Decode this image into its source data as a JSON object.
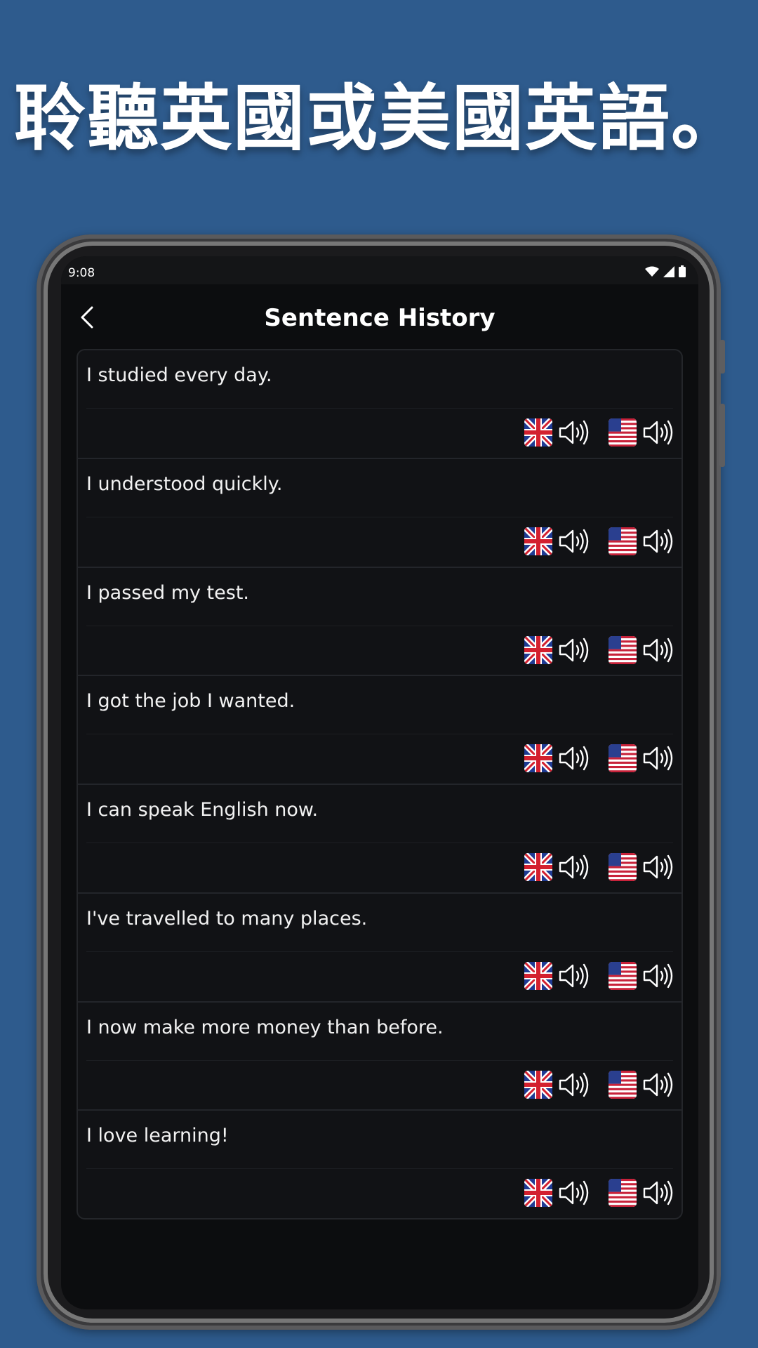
{
  "headline": "聆聽英國或美國英語。",
  "status_bar": {
    "time": "9:08"
  },
  "app_bar": {
    "title": "Sentence History"
  },
  "sentences": [
    {
      "text": "I studied every day."
    },
    {
      "text": "I understood quickly."
    },
    {
      "text": "I passed my test."
    },
    {
      "text": "I got the job I wanted."
    },
    {
      "text": "I can speak English now."
    },
    {
      "text": "I've travelled to many places."
    },
    {
      "text": "I now make more money than before."
    },
    {
      "text": "I love learning!"
    }
  ],
  "item_actions": [
    {
      "flag_icon": "uk-flag-icon",
      "speaker_icon": "speaker-icon"
    },
    {
      "flag_icon": "us-flag-icon",
      "speaker_icon": "speaker-icon"
    }
  ],
  "colors": {
    "background": "#2e5b8d",
    "screen": "#0c0d0f",
    "card": "#111215",
    "text": "#f2f2f2"
  }
}
